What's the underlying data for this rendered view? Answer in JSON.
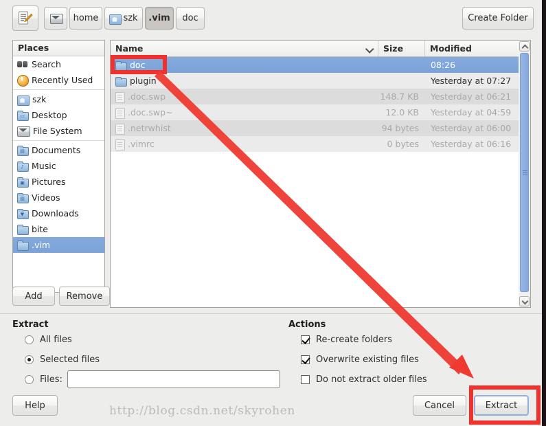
{
  "window": {
    "title": "Extract",
    "watermark": "http://blog.csdn.net/skyrohen"
  },
  "pathbar": {
    "type_path_button": {
      "name": "type-a-file-name",
      "icon": "document-pencil-icon"
    },
    "create_folder_label": "Create Folder",
    "crumbs": [
      {
        "label": "",
        "icon": "drive-icon",
        "active": false
      },
      {
        "label": "home",
        "icon": "",
        "active": false
      },
      {
        "label": "szk",
        "icon": "home-icon",
        "active": false
      },
      {
        "label": ".vim",
        "icon": "",
        "active": true
      },
      {
        "label": "doc",
        "icon": "",
        "active": false
      }
    ]
  },
  "places": {
    "header": "Places",
    "add_label": "Add",
    "remove_label": "Remove",
    "items": [
      {
        "label": "Search",
        "icon": "search-icon",
        "selected": false,
        "sep_after": false
      },
      {
        "label": "Recently Used",
        "icon": "recent-icon",
        "selected": false,
        "sep_after": true
      },
      {
        "label": "szk",
        "icon": "home-folder-icon",
        "selected": false,
        "sep_after": false
      },
      {
        "label": "Desktop",
        "icon": "desktop-folder-icon",
        "selected": false,
        "sep_after": false
      },
      {
        "label": "File System",
        "icon": "drive-icon",
        "selected": false,
        "sep_after": true
      },
      {
        "label": "Documents",
        "icon": "documents-folder-icon",
        "selected": false,
        "sep_after": false
      },
      {
        "label": "Music",
        "icon": "music-folder-icon",
        "selected": false,
        "sep_after": false
      },
      {
        "label": "Pictures",
        "icon": "pictures-folder-icon",
        "selected": false,
        "sep_after": false
      },
      {
        "label": "Videos",
        "icon": "videos-folder-icon",
        "selected": false,
        "sep_after": false
      },
      {
        "label": "Downloads",
        "icon": "downloads-folder-icon",
        "selected": false,
        "sep_after": false
      },
      {
        "label": "bite",
        "icon": "folder-icon",
        "selected": false,
        "sep_after": false
      },
      {
        "label": ".vim",
        "icon": "folder-icon",
        "selected": true,
        "sep_after": false
      }
    ]
  },
  "filelist": {
    "columns": [
      "Name",
      "Size",
      "Modified"
    ],
    "sort_column": "Name",
    "sort_direction": "descending",
    "rows": [
      {
        "name": "doc",
        "size": "",
        "modified": "08:26",
        "icon": "folder-icon",
        "selected": true,
        "dim": false
      },
      {
        "name": "plugin",
        "size": "",
        "modified": "Yesterday at 07:27",
        "icon": "folder-icon",
        "selected": false,
        "dim": false
      },
      {
        "name": ".doc.swp",
        "size": "148.7 KB",
        "modified": "Yesterday at 06:21",
        "icon": "file-icon",
        "selected": false,
        "dim": true
      },
      {
        "name": ".doc.swp~",
        "size": "12.0 KB",
        "modified": "Yesterday at 04:59",
        "icon": "file-icon",
        "selected": false,
        "dim": true
      },
      {
        "name": ".netrwhist",
        "size": "94 bytes",
        "modified": "Yesterday at 06:00",
        "icon": "file-icon",
        "selected": false,
        "dim": true
      },
      {
        "name": ".vimrc",
        "size": "0 bytes",
        "modified": "Yesterday at 06:16",
        "icon": "file-icon",
        "selected": false,
        "dim": true
      }
    ]
  },
  "extract_group": {
    "title": "Extract",
    "options": [
      {
        "label": "All files",
        "selected": false
      },
      {
        "label": "Selected files",
        "selected": true
      },
      {
        "label": "Files:",
        "selected": false
      }
    ],
    "files_input_value": "",
    "files_input_placeholder": ""
  },
  "actions_group": {
    "title": "Actions",
    "options": [
      {
        "label": "Re-create folders",
        "checked": true
      },
      {
        "label": "Overwrite existing files",
        "checked": true
      },
      {
        "label": "Do not extract older files",
        "checked": false
      }
    ]
  },
  "buttons": {
    "help": "Help",
    "cancel": "Cancel",
    "extract": "Extract"
  },
  "annotations": {
    "highlight_color": "#f3312c",
    "boxes": [
      "doc-row",
      "extract-button"
    ],
    "arrow_from": "doc-row",
    "arrow_to": "extract-button"
  }
}
